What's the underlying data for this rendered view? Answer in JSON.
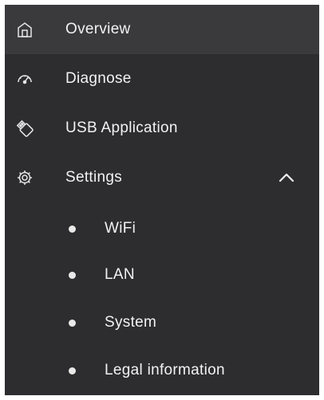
{
  "sidebar": {
    "items": [
      {
        "label": "Overview",
        "icon": "home-icon",
        "active": true
      },
      {
        "label": "Diagnose",
        "icon": "speedometer-icon"
      },
      {
        "label": "USB Application",
        "icon": "usb-icon"
      },
      {
        "label": "Settings",
        "icon": "gear-icon",
        "expanded": true
      }
    ],
    "settings_submenu": [
      {
        "label": "WiFi"
      },
      {
        "label": "LAN"
      },
      {
        "label": "System"
      },
      {
        "label": "Legal information"
      }
    ]
  },
  "colors": {
    "background": "#2d2d2f",
    "active_background": "#3a3a3d",
    "text": "#f2f2f2"
  }
}
